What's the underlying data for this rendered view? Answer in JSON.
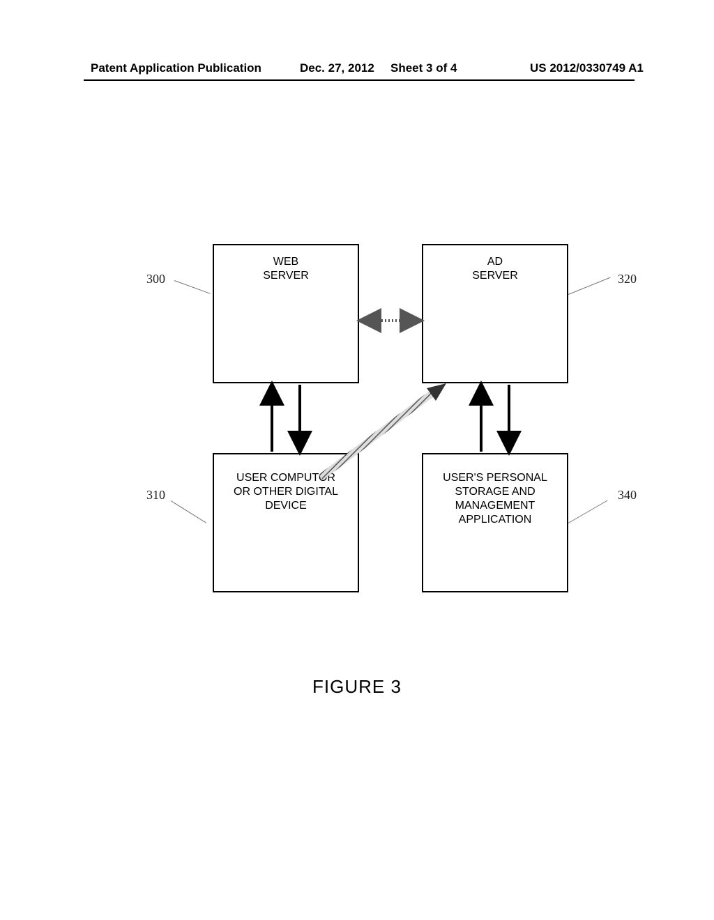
{
  "header": {
    "left": "Patent Application Publication",
    "date": "Dec. 27, 2012",
    "sheet": "Sheet 3 of 4",
    "pubnum": "US 2012/0330749 A1"
  },
  "boxes": {
    "web": "WEB\nSERVER",
    "ad": "AD\nSERVER",
    "user": "USER COMPUTOR\nOR OTHER DIGITAL\nDEVICE",
    "storage": "USER'S PERSONAL\nSTORAGE AND\nMANAGEMENT\nAPPLICATION"
  },
  "refs": {
    "r300": "300",
    "r310": "310",
    "r320": "320",
    "r340": "340"
  },
  "caption": "FIGURE 3",
  "chart_data": {
    "type": "diagram",
    "nodes": [
      {
        "id": "300",
        "label": "WEB SERVER"
      },
      {
        "id": "320",
        "label": "AD SERVER"
      },
      {
        "id": "310",
        "label": "USER COMPUTOR OR OTHER DIGITAL DEVICE"
      },
      {
        "id": "340",
        "label": "USER'S PERSONAL STORAGE AND MANAGEMENT APPLICATION"
      }
    ],
    "edges": [
      {
        "from": "300",
        "to": "320",
        "direction": "both",
        "style": "dotted"
      },
      {
        "from": "300",
        "to": "310",
        "direction": "both",
        "style": "solid"
      },
      {
        "from": "320",
        "to": "340",
        "direction": "both",
        "style": "solid"
      },
      {
        "from": "310",
        "to": "320",
        "direction": "one",
        "style": "hatched"
      }
    ],
    "title": "FIGURE 3"
  }
}
